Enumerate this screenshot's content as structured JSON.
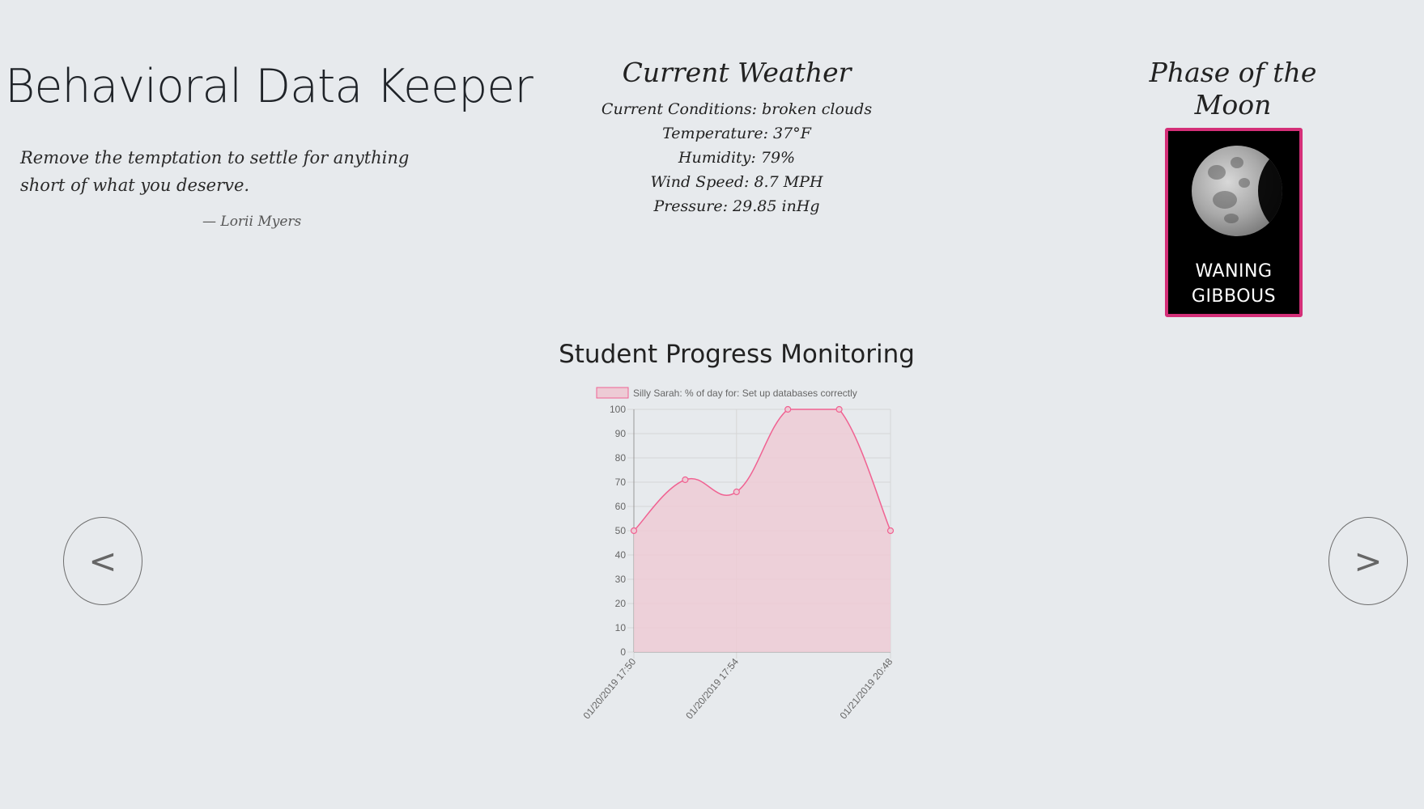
{
  "header": {
    "app_title": "Behavioral Data Keeper",
    "quote": "Remove the temptation to settle for anything short of what you deserve.",
    "quote_author": "— Lorii Myers"
  },
  "weather": {
    "heading": "Current Weather",
    "conditions": "Current Conditions: broken clouds",
    "temperature": "Temperature: 37°F",
    "humidity": "Humidity: 79%",
    "wind": "Wind Speed: 8.7 MPH",
    "pressure": "Pressure: 29.85 inHg"
  },
  "moon": {
    "heading": "Phase of the Moon",
    "phase": "Waning Gibbous",
    "card_label_line1": "WANING",
    "card_label_line2": "GIBBOUS",
    "border_color": "#d42f78"
  },
  "nav": {
    "prev_label": "<",
    "next_label": ">"
  },
  "chart_title": "Student Progress Monitoring",
  "chart_data": {
    "type": "area",
    "series": [
      {
        "name": "Silly Sarah: % of day for: Set up databases correctly",
        "values": [
          50,
          71,
          66,
          100,
          100,
          50
        ],
        "color": "#f06292",
        "fill": "#edcbd5"
      }
    ],
    "x_tick_labels": [
      "01/20/2019 17:50",
      "01/20/2019 17:54",
      "01/21/2019 20:48"
    ],
    "x_tick_label_positions": [
      0,
      2,
      5
    ],
    "ylim": [
      0,
      100
    ],
    "yticks": [
      0,
      10,
      20,
      30,
      40,
      50,
      60,
      70,
      80,
      90,
      100
    ],
    "grid": true,
    "legend": "top"
  }
}
